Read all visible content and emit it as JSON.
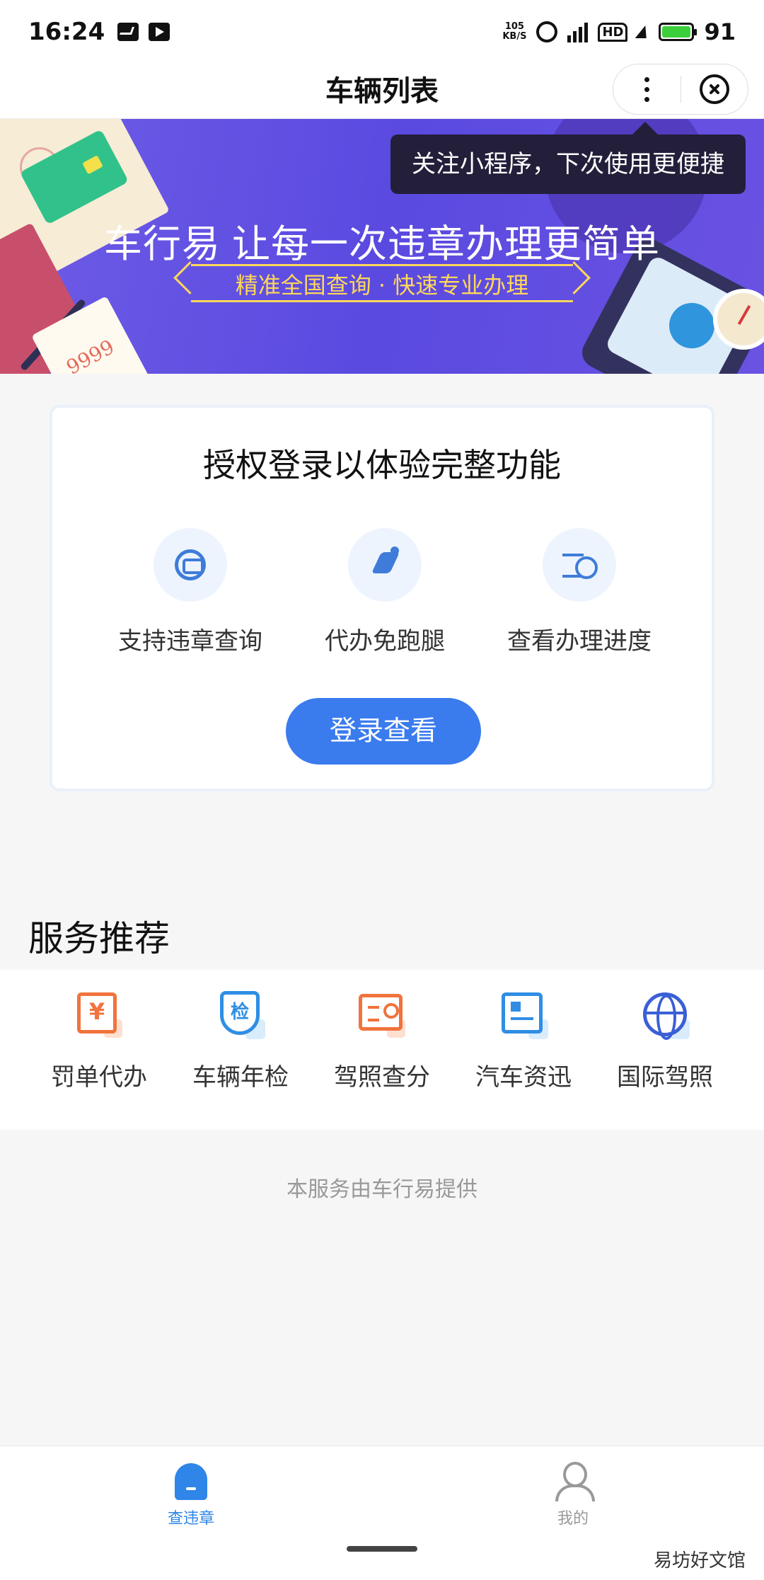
{
  "status_bar": {
    "time": "16:24",
    "net_speed_value": "105",
    "net_speed_unit": "KB/S",
    "network_type": "4G",
    "hd_label": "HD",
    "battery_level": "91"
  },
  "nav": {
    "title": "车辆列表"
  },
  "banner": {
    "headline": "车行易 让每一次违章办理更简单",
    "subline": "精准全国查询 · 快速专业办理",
    "ticket_text": "9999"
  },
  "tooltip": {
    "text": "关注小程序，下次使用更便捷"
  },
  "login_card": {
    "title": "授权登录以体验完整功能",
    "features": [
      {
        "label": "支持违章查询",
        "icon": "car-search-icon"
      },
      {
        "label": "代办免跑腿",
        "icon": "running-man-icon"
      },
      {
        "label": "查看办理进度",
        "icon": "progress-clock-icon"
      }
    ],
    "button_label": "登录查看"
  },
  "services": {
    "title": "服务推荐",
    "items": [
      {
        "label": "罚单代办",
        "icon": "yen-ticket-icon",
        "glyph": "¥"
      },
      {
        "label": "车辆年检",
        "icon": "inspection-shield-icon",
        "glyph": "检"
      },
      {
        "label": "驾照查分",
        "icon": "license-search-icon"
      },
      {
        "label": "汽车资迅",
        "icon": "news-card-icon"
      },
      {
        "label": "国际驾照",
        "icon": "globe-icon"
      }
    ]
  },
  "provider_note": "本服务由车行易提供",
  "tab_bar": {
    "tabs": [
      {
        "label": "查违章",
        "active": true
      },
      {
        "label": "我的",
        "active": false
      }
    ],
    "active_color": "#2f86e8",
    "inactive_color": "#999999"
  },
  "watermark": "易坊好文馆",
  "colors": {
    "primary_button": "#3a7bee",
    "banner_purple": "#5a4ae0",
    "accent_orange": "#f1733d",
    "accent_blue": "#2f8ee4"
  }
}
